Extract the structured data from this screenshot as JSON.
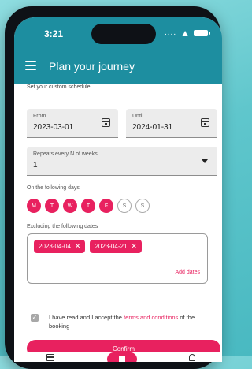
{
  "status": {
    "time": "3:21",
    "signal": "....",
    "wifi": "▲"
  },
  "appbar": {
    "title": "Plan your journey"
  },
  "form": {
    "helper": "Set your custom schedule.",
    "from": {
      "label": "From",
      "value": "2023-03-01"
    },
    "until": {
      "label": "Until",
      "value": "2024-01-31"
    },
    "repeat": {
      "label": "Repeats every N of weeks",
      "value": "1"
    },
    "days_label": "On the following days",
    "days": [
      {
        "letter": "M",
        "selected": true
      },
      {
        "letter": "T",
        "selected": true
      },
      {
        "letter": "W",
        "selected": true
      },
      {
        "letter": "T",
        "selected": true
      },
      {
        "letter": "F",
        "selected": true
      },
      {
        "letter": "S",
        "selected": false
      },
      {
        "letter": "S",
        "selected": false
      }
    ],
    "excluding_label": "Excluding the following dates",
    "excluded_dates": [
      "2023-04-04",
      "2023-04-21"
    ],
    "chip_remove": "✕",
    "add_dates": "Add dates",
    "terms": {
      "prefix": "I have read and I accept the ",
      "link": "terms and conditions",
      "suffix": " of the booking",
      "checked": true
    },
    "confirm": "Confirm"
  },
  "colors": {
    "primary": "#1d8ea0",
    "accent": "#e8215f"
  }
}
